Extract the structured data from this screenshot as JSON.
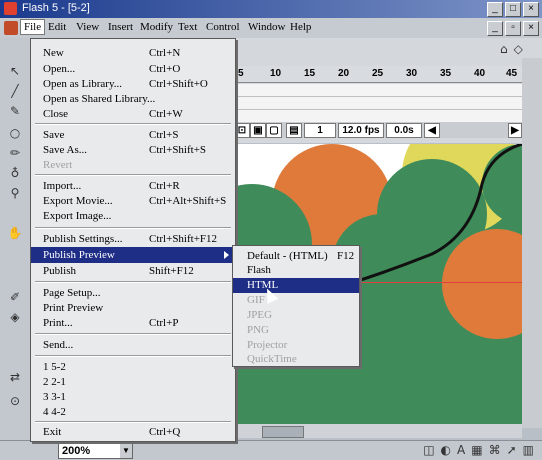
{
  "window": {
    "title": "Flash 5 - [5-2]"
  },
  "menubar": {
    "items": [
      "File",
      "Edit",
      "View",
      "Insert",
      "Modify",
      "Text",
      "Control",
      "Window",
      "Help"
    ]
  },
  "timeline": {
    "ruler": [
      "5",
      "10",
      "15",
      "20",
      "25",
      "30",
      "35",
      "40",
      "45"
    ],
    "frame": "1",
    "fps": "12.0 fps",
    "time": "0.0s"
  },
  "file_menu": [
    {
      "label": "New",
      "shortcut": "Ctrl+N"
    },
    {
      "label": "Open...",
      "shortcut": "Ctrl+O"
    },
    {
      "label": "Open as Library...",
      "shortcut": "Ctrl+Shift+O"
    },
    {
      "label": "Open as Shared Library...",
      "shortcut": ""
    },
    {
      "label": "Close",
      "shortcut": "Ctrl+W"
    },
    {
      "label": "Save",
      "shortcut": "Ctrl+S"
    },
    {
      "label": "Save As...",
      "shortcut": "Ctrl+Shift+S"
    },
    {
      "label": "Revert",
      "shortcut": ""
    },
    {
      "label": "Import...",
      "shortcut": "Ctrl+R"
    },
    {
      "label": "Export Movie...",
      "shortcut": "Ctrl+Alt+Shift+S"
    },
    {
      "label": "Export Image...",
      "shortcut": ""
    },
    {
      "label": "Publish Settings...",
      "shortcut": "Ctrl+Shift+F12"
    },
    {
      "label": "Publish Preview",
      "shortcut": ""
    },
    {
      "label": "Publish",
      "shortcut": "Shift+F12"
    },
    {
      "label": "Page Setup...",
      "shortcut": ""
    },
    {
      "label": "Print Preview",
      "shortcut": ""
    },
    {
      "label": "Print...",
      "shortcut": "Ctrl+P"
    },
    {
      "label": "Send...",
      "shortcut": ""
    },
    {
      "label": "1 5-2",
      "shortcut": ""
    },
    {
      "label": "2 2-1",
      "shortcut": ""
    },
    {
      "label": "3 3-1",
      "shortcut": ""
    },
    {
      "label": "4 4-2",
      "shortcut": ""
    },
    {
      "label": "Exit",
      "shortcut": "Ctrl+Q"
    }
  ],
  "publish_preview_menu": [
    {
      "label": "Default - (HTML)",
      "shortcut": "F12"
    },
    {
      "label": "Flash",
      "shortcut": ""
    },
    {
      "label": "HTML",
      "shortcut": ""
    },
    {
      "label": "GIF",
      "shortcut": ""
    },
    {
      "label": "JPEG",
      "shortcut": ""
    },
    {
      "label": "PNG",
      "shortcut": ""
    },
    {
      "label": "Projector",
      "shortcut": ""
    },
    {
      "label": "QuickTime",
      "shortcut": ""
    }
  ],
  "status": {
    "zoom": "200%"
  },
  "colors": {
    "green": "#3f8c5a",
    "orange": "#e07a3a",
    "yellow": "#e0d85a",
    "highlight": "#1e2e86"
  }
}
